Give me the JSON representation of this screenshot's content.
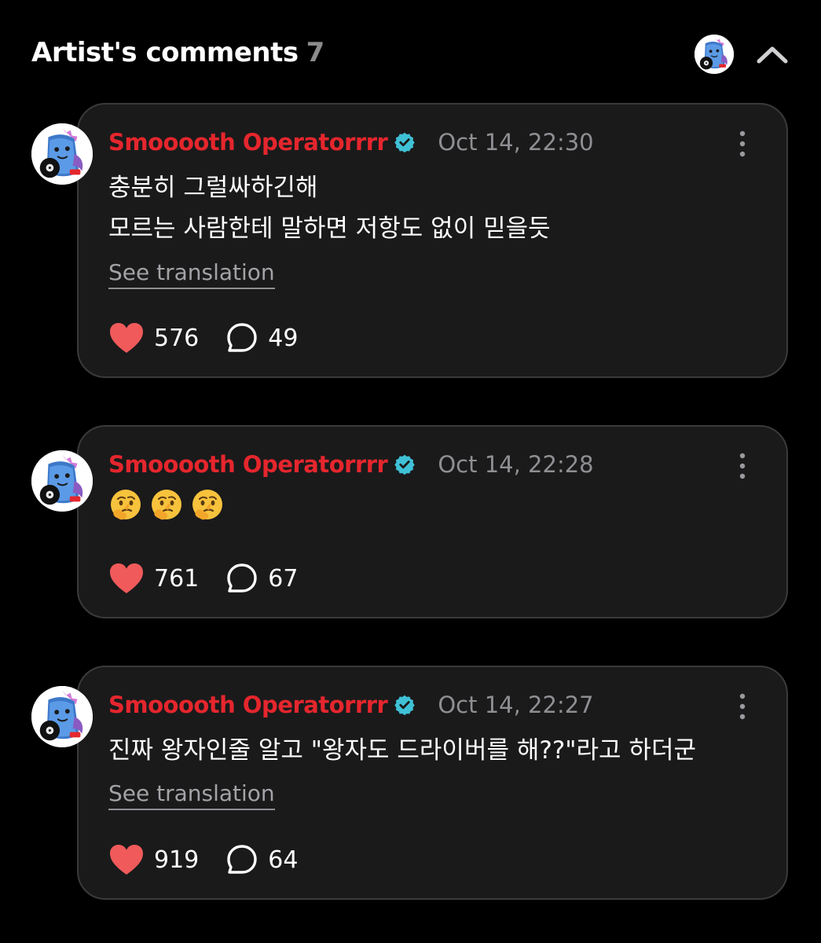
{
  "header": {
    "title": "Artist's comments",
    "count": "7"
  },
  "icons": {
    "collapse": "chevron-up-icon",
    "like": "heart-icon",
    "reply": "speech-bubble-icon",
    "verified": "verified-badge-icon",
    "more": "vertical-ellipsis-icon",
    "emoji": "thinking-face-emoji"
  },
  "colors": {
    "background": "#000000",
    "card": "#1a1a1b",
    "author": "#e5262d",
    "verified": "#3fc1d6",
    "heart": "#f05a5a",
    "muted": "#8f8f93"
  },
  "comments": [
    {
      "author": "Smooooth Operatorrrr",
      "time": "Oct 14, 22:30",
      "lines": [
        "충분히 그럴싸하긴해",
        "모르는 사람한테 말하면 저항도 없이 믿을듯"
      ],
      "see_translation": "See translation",
      "likes": "576",
      "replies": "49"
    },
    {
      "author": "Smooooth Operatorrrr",
      "time": "Oct 14, 22:28",
      "emojis": [
        "🤔",
        "🤔",
        "🤔"
      ],
      "likes": "761",
      "replies": "67"
    },
    {
      "author": "Smooooth Operatorrrr",
      "time": "Oct 14, 22:27",
      "lines": [
        "진짜 왕자인줄 알고 \"왕자도 드라이버를 해??\"라고 하더군"
      ],
      "see_translation": "See translation",
      "likes": "919",
      "replies": "64"
    }
  ]
}
